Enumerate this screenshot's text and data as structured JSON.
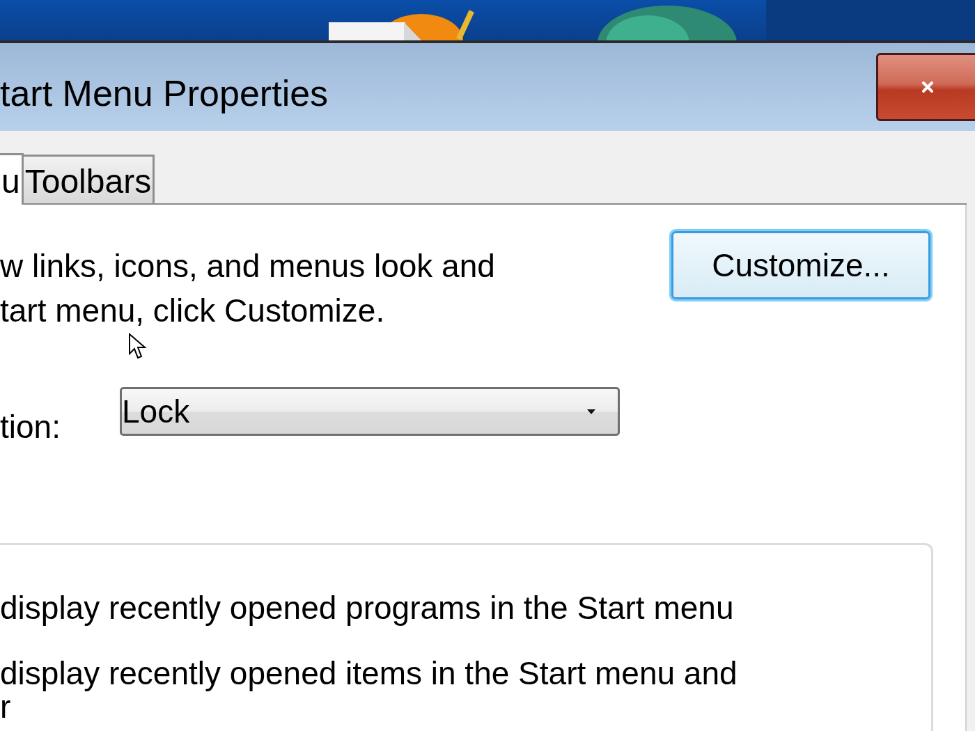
{
  "window": {
    "title": "tart Menu Properties"
  },
  "tabs": [
    {
      "label": "u",
      "selected": true
    },
    {
      "label": "Toolbars",
      "selected": false
    }
  ],
  "start_menu": {
    "description_lines": [
      "w links, icons, and menus look and",
      "tart menu, click Customize."
    ],
    "customize_button": {
      "label": "Customize...",
      "focused": true
    }
  },
  "power_button_action": {
    "label": "tion:",
    "value": "Lock"
  },
  "privacy": {
    "items": [
      {
        "lines": [
          "display recently opened programs in the Start menu"
        ]
      },
      {
        "lines": [
          "display recently opened items in the Start menu and",
          "r"
        ]
      }
    ]
  }
}
